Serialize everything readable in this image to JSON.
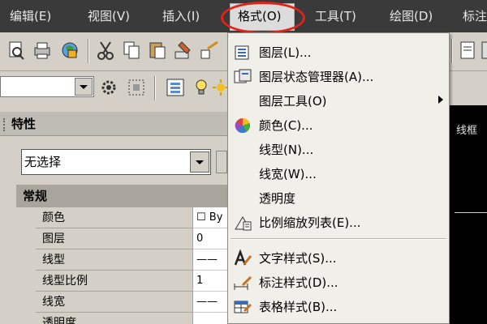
{
  "menubar": {
    "items": [
      {
        "label": "编辑(E)"
      },
      {
        "label": "视图(V)"
      },
      {
        "label": "插入(I)"
      },
      {
        "label": "格式(O)"
      },
      {
        "label": "工具(T)"
      },
      {
        "label": "绘图(D)"
      },
      {
        "label": "标注"
      }
    ]
  },
  "format_menu": {
    "items": [
      {
        "label": "图层(L)...",
        "icon": "layers-icon"
      },
      {
        "label": "图层状态管理器(A)...",
        "icon": "layer-states-icon"
      },
      {
        "label": "图层工具(O)",
        "icon": "",
        "submenu": true
      },
      {
        "label": "颜色(C)...",
        "icon": "color-wheel-icon"
      },
      {
        "label": "线型(N)...",
        "icon": ""
      },
      {
        "label": "线宽(W)...",
        "icon": ""
      },
      {
        "label": "透明度",
        "icon": ""
      },
      {
        "label": "比例缩放列表(E)...",
        "icon": "scale-list-icon"
      },
      {
        "label": "文字样式(S)...",
        "icon": "text-style-icon"
      },
      {
        "label": "标注样式(D)...",
        "icon": "dim-style-icon"
      },
      {
        "label": "表格样式(B)...",
        "icon": "table-style-icon"
      }
    ]
  },
  "properties_palette": {
    "title": "特性",
    "selection": "无选择",
    "section": "常规",
    "rows": [
      {
        "name": "颜色",
        "value": "☐ By"
      },
      {
        "name": "图层",
        "value": "0"
      },
      {
        "name": "线型",
        "value": "——"
      },
      {
        "name": "线型比例",
        "value": "1"
      },
      {
        "name": "线宽",
        "value": "——"
      },
      {
        "name": "透明度",
        "value": ""
      }
    ]
  },
  "viewport": {
    "label": "线框"
  },
  "colors": {
    "highlight": "#e2231a",
    "menubar": "#3a3a3a",
    "menu_bg": "#f0efea"
  }
}
